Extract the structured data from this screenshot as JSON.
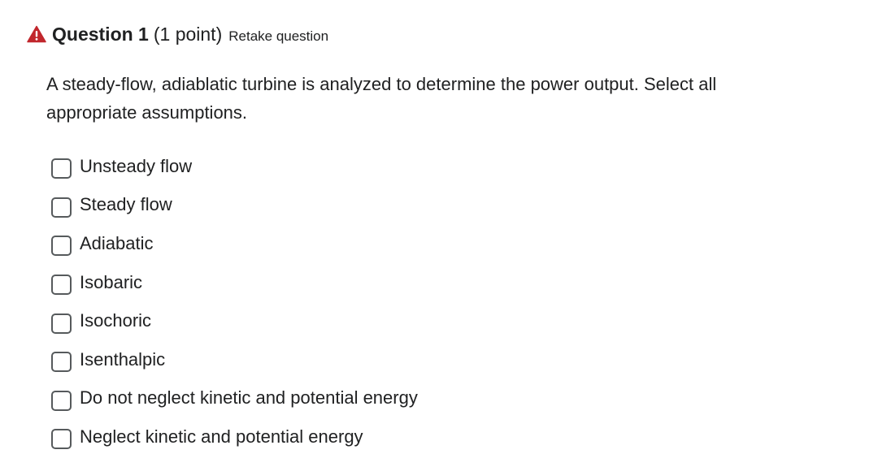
{
  "question": {
    "warning_icon": "warning-triangle-icon",
    "warning_color": "#c1272d",
    "title": "Question 1",
    "points": "(1 point)",
    "retake_label": "Retake question",
    "prompt": "A steady-flow, adiablatic turbine is analyzed to determine the power output. Select all appropriate assumptions."
  },
  "options": [
    {
      "label": "Unsteady flow",
      "checked": false
    },
    {
      "label": "Steady flow",
      "checked": false
    },
    {
      "label": "Adiabatic",
      "checked": false
    },
    {
      "label": "Isobaric",
      "checked": false
    },
    {
      "label": "Isochoric",
      "checked": false
    },
    {
      "label": "Isenthalpic",
      "checked": false
    },
    {
      "label": "Do not neglect kinetic and potential energy",
      "checked": false
    },
    {
      "label": "Neglect kinetic and potential energy",
      "checked": false
    }
  ]
}
